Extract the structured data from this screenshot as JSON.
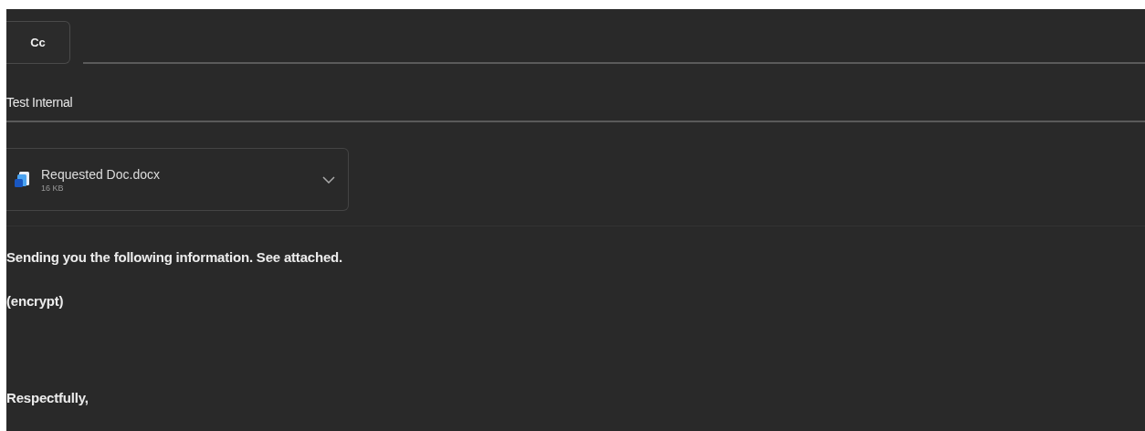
{
  "cc": {
    "label": "Cc"
  },
  "subject": {
    "value": "Test Internal"
  },
  "attachments": [
    {
      "name": "Requested Doc.docx",
      "size": "16 KB"
    }
  ],
  "body": [
    "Sending you the following information. See attached.",
    "(encrypt)",
    "Respectfully,"
  ]
}
